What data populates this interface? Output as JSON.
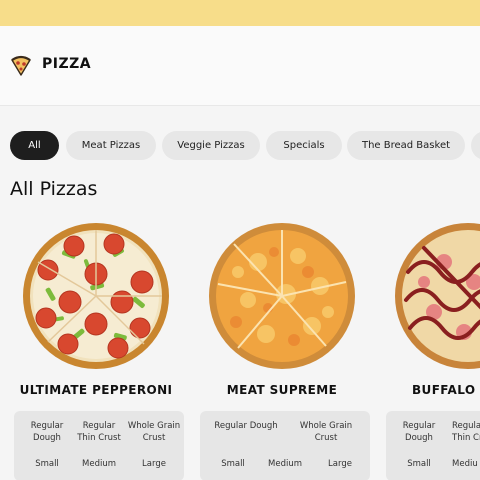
{
  "header": {
    "brand": "PIZZA",
    "logo_icon": "pizza-slice-icon"
  },
  "categories": [
    {
      "label": "All",
      "active": true
    },
    {
      "label": "Meat Pizzas",
      "active": false
    },
    {
      "label": "Veggie Pizzas",
      "active": false
    },
    {
      "label": "Specials",
      "active": false
    },
    {
      "label": "The Bread Basket",
      "active": false
    }
  ],
  "section": {
    "title": "All Pizzas"
  },
  "pizzas": [
    {
      "name": "ULTIMATE PEPPERONI",
      "crusts": [
        "Regular Dough",
        "Regular Thin Crust",
        "Whole Grain Crust"
      ],
      "sizes": [
        "Small",
        "Medium",
        "Large"
      ]
    },
    {
      "name": "MEAT SUPREME",
      "crusts": [
        "Regular Dough",
        "Whole Grain Crust"
      ],
      "sizes": [
        "Small",
        "Medium",
        "Large"
      ]
    },
    {
      "name": "BUFFALO C",
      "crusts": [
        "Regular Dough",
        "Regula Thin Cr"
      ],
      "sizes": [
        "Small",
        "Mediu"
      ]
    }
  ],
  "colors": {
    "topbar": "#f7dd8a",
    "active_chip": "#1e1e1e",
    "chip": "#e7e7e7"
  }
}
